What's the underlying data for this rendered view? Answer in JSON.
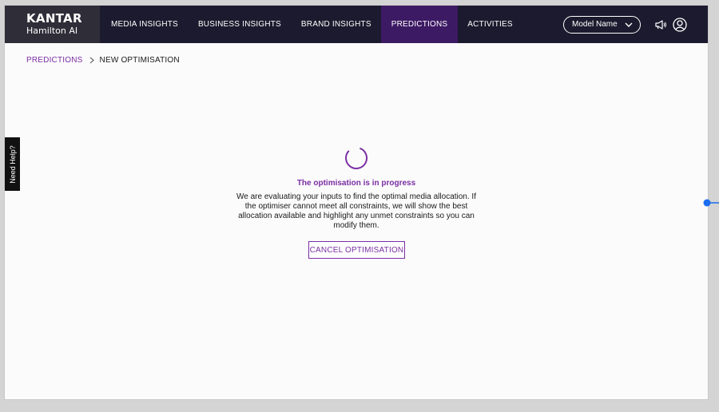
{
  "brand": {
    "name": "KANTAR",
    "subtitle": "Hamilton AI"
  },
  "nav": {
    "items": [
      {
        "label": "MEDIA INSIGHTS"
      },
      {
        "label": "BUSINESS INSIGHTS"
      },
      {
        "label": "BRAND INSIGHTS"
      },
      {
        "label": "PREDICTIONS",
        "active": true
      },
      {
        "label": "ACTIVITIES"
      }
    ],
    "model_select": "Model Name"
  },
  "breadcrumb": {
    "parent": "PREDICTIONS",
    "current": "NEW OPTIMISATION"
  },
  "help_tab": "Need Help?",
  "progress": {
    "title": "The optimisation is in progress",
    "message": "We are evaluating your inputs to find the optimal media allocation. If the optimiser cannot meet all constraints, we will show the best allocation available and highlight any unmet constraints so you can modify them.",
    "cancel_label": "CANCEL OPTIMISATION"
  },
  "colors": {
    "nav_bg": "#1c1a2e",
    "brand_bg": "#2e2d38",
    "active_tab_bg": "#3d1a64",
    "accent_purple": "#7a2ea3",
    "handle_blue": "#1a6cf0"
  },
  "icons": {
    "model_chevron": "chevron-down-icon",
    "announcements": "megaphone-icon",
    "account": "user-icon",
    "breadcrumb_separator": "chevron-right-icon",
    "loading": "spinner-icon"
  }
}
